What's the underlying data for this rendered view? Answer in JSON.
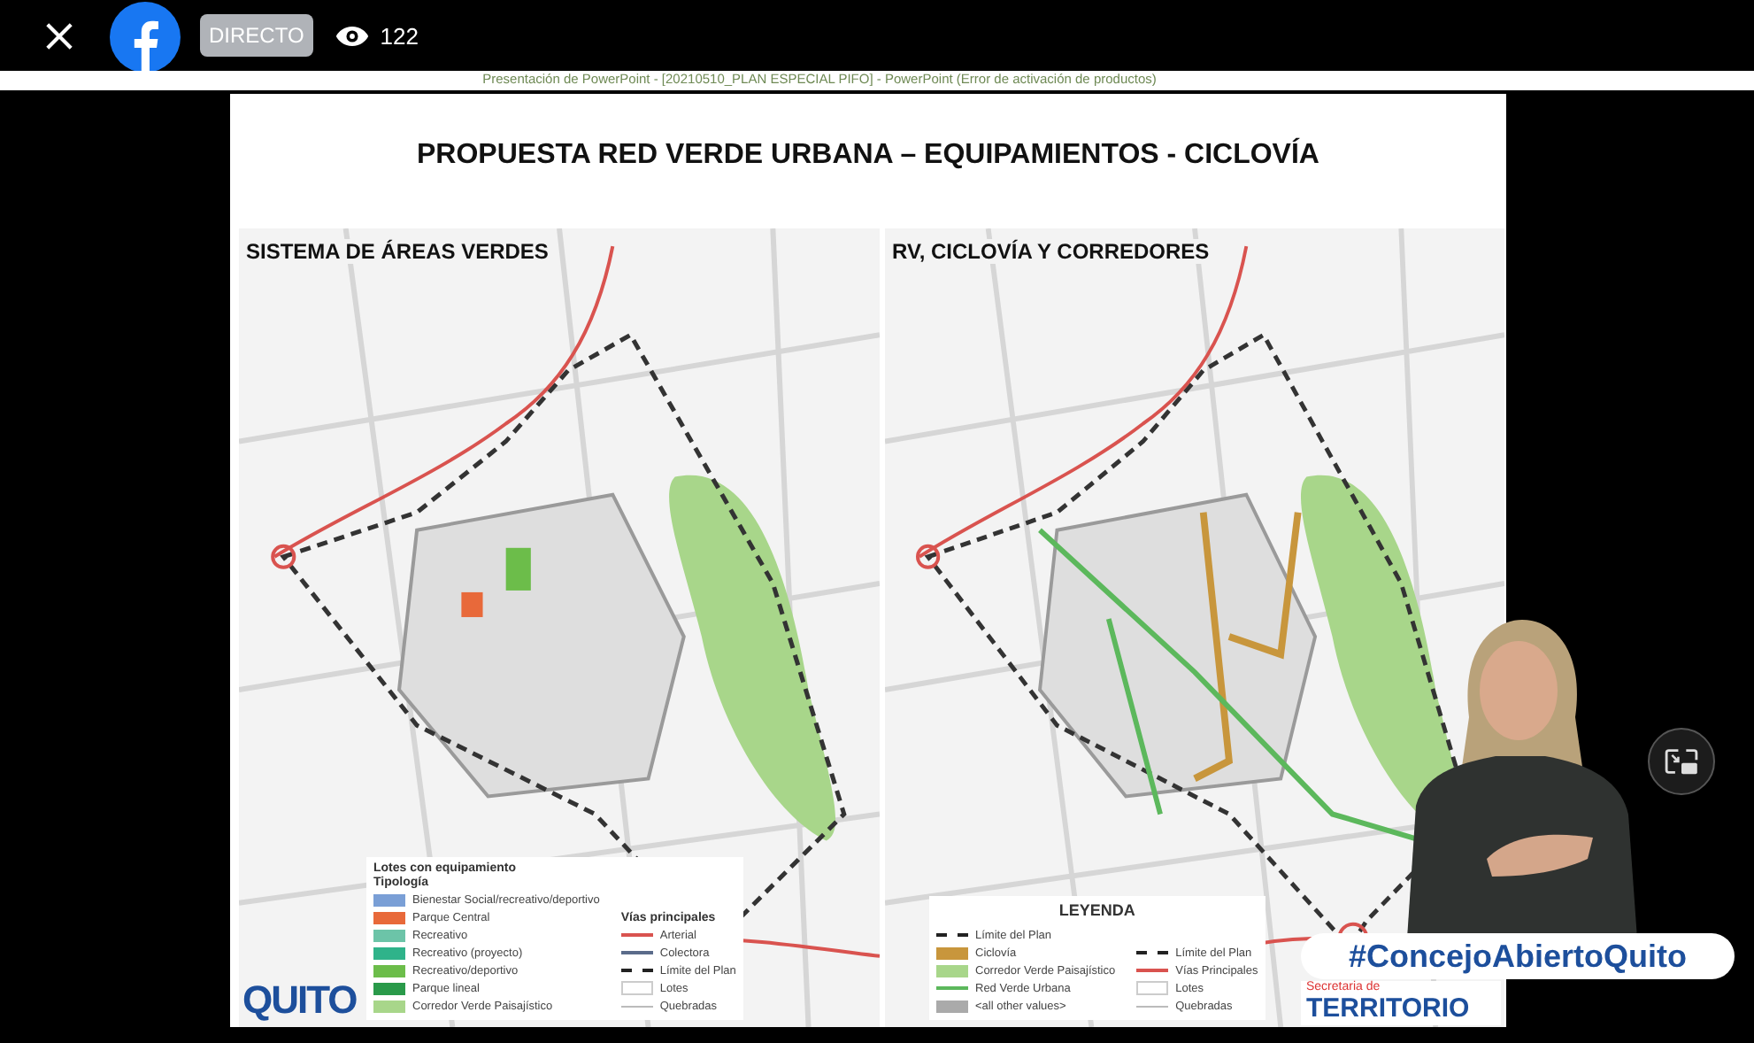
{
  "top_bar": {
    "live_badge": "DIRECTO",
    "viewers": "122"
  },
  "window": {
    "title": "Presentación de PowerPoint - [20210510_PLAN ESPECIAL PIFO] - PowerPoint (Error de activación de productos)"
  },
  "slide": {
    "title": "PROPUESTA RED VERDE URBANA – EQUIPAMIENTOS - CICLOVÍA",
    "maps": [
      {
        "subtitle": "SISTEMA DE ÁREAS VERDES",
        "legend": {
          "title": "Lotes con equipamiento",
          "groups": [
            {
              "title": "Tipología",
              "items": [
                {
                  "kind": "swatch",
                  "color": "#7a9fd6",
                  "label": "Bienestar Social/recreativo/deportivo"
                },
                {
                  "kind": "swatch",
                  "color": "#e8693a",
                  "label": "Parque Central"
                },
                {
                  "kind": "swatch",
                  "color": "#6cc4a8",
                  "label": "Recreativo"
                },
                {
                  "kind": "swatch",
                  "color": "#2fb38a",
                  "label": "Recreativo (proyecto)"
                },
                {
                  "kind": "swatch",
                  "color": "#6cbd4a",
                  "label": "Recreativo/deportivo"
                },
                {
                  "kind": "swatch",
                  "color": "#2a9a4a",
                  "label": "Parque lineal"
                },
                {
                  "kind": "swatch",
                  "color": "#a8d68a",
                  "label": "Corredor Verde Paisajístico"
                }
              ]
            },
            {
              "title": "Vías principales",
              "items": [
                {
                  "kind": "line",
                  "color": "#d9534f",
                  "label": "Arterial"
                },
                {
                  "kind": "line",
                  "color": "#5a6b8a",
                  "label": "Colectora"
                },
                {
                  "kind": "dashed",
                  "color": "#222222",
                  "label": "Límite del Plan"
                },
                {
                  "kind": "box",
                  "color": "#cccccc",
                  "label": "Lotes"
                },
                {
                  "kind": "thin",
                  "color": "#bbbbbb",
                  "label": "Quebradas"
                }
              ]
            }
          ]
        }
      },
      {
        "subtitle": "RV, CICLOVÍA Y CORREDORES",
        "legend": {
          "title": "LEYENDA",
          "groups": [
            {
              "items": [
                {
                  "kind": "dashed",
                  "color": "#222222",
                  "label": "Límite del Plan"
                },
                {
                  "kind": "swatch",
                  "color": "#c8963c",
                  "label": "Ciclovía"
                },
                {
                  "kind": "swatch",
                  "color": "#a8d68a",
                  "label": "Corredor Verde Paisajístico"
                },
                {
                  "kind": "line",
                  "color": "#5cb85c",
                  "label": "Red Verde Urbana"
                },
                {
                  "kind": "swatch",
                  "color": "#aaaaaa",
                  "label": "<all other values>"
                }
              ]
            },
            {
              "items": [
                {
                  "kind": "dashed",
                  "color": "#222222",
                  "label": "Límite del Plan"
                },
                {
                  "kind": "line",
                  "color": "#d9534f",
                  "label": "Vías Principales"
                },
                {
                  "kind": "box",
                  "color": "#cccccc",
                  "label": "Lotes"
                },
                {
                  "kind": "thin",
                  "color": "#bbbbbb",
                  "label": "Quebradas"
                }
              ]
            }
          ]
        }
      }
    ],
    "logo": "QUITO"
  },
  "overlay": {
    "hashtag": "#ConcejoAbiertoQuito",
    "agency_small": "Secretaria de",
    "agency": "TERRITORIO"
  }
}
